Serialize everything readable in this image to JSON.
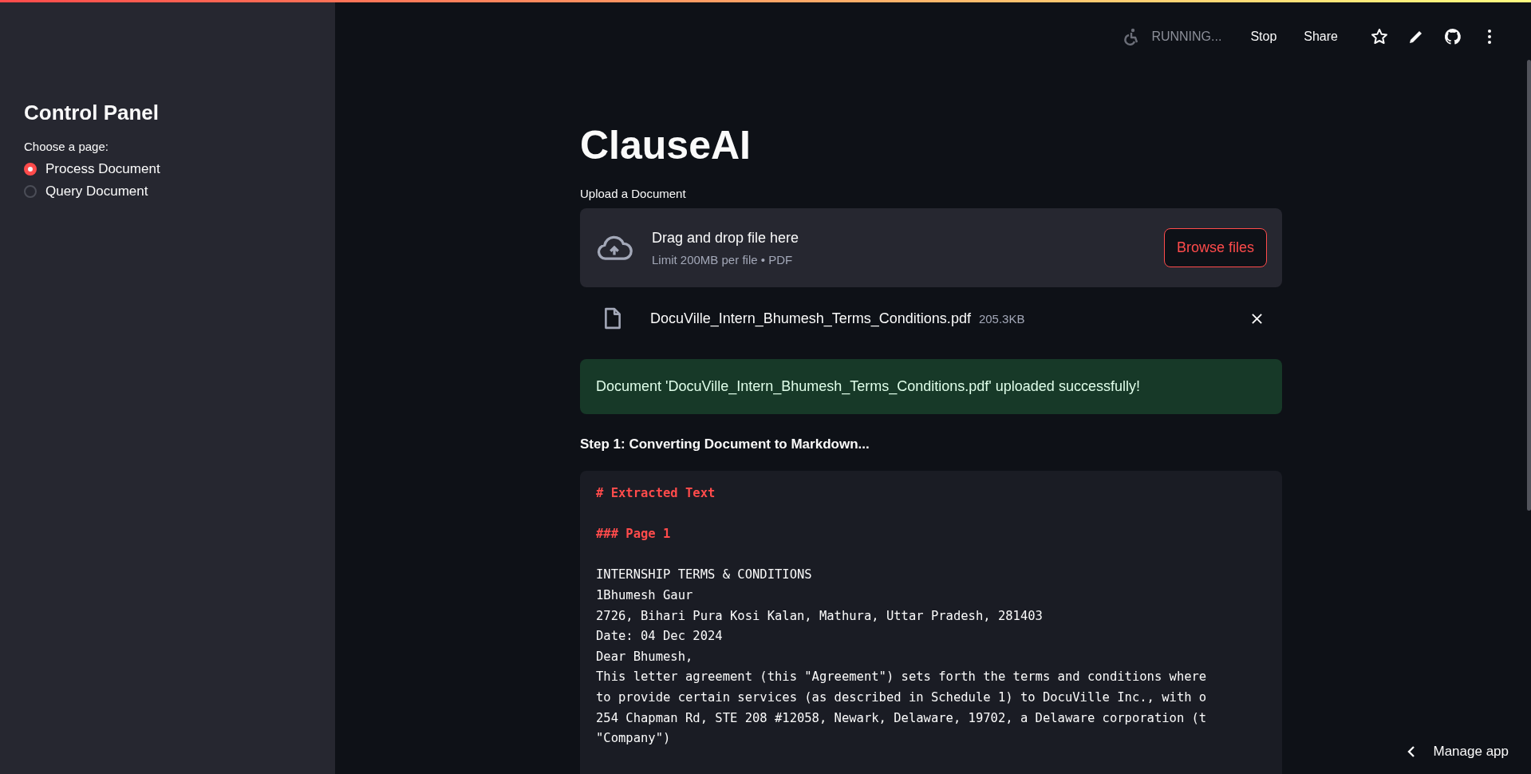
{
  "sidebar": {
    "title": "Control Panel",
    "radio_label": "Choose a page:",
    "options": [
      {
        "label": "Process Document",
        "selected": true
      },
      {
        "label": "Query Document",
        "selected": false
      }
    ]
  },
  "header": {
    "status": "RUNNING...",
    "buttons": [
      "Stop",
      "Share"
    ]
  },
  "main": {
    "title": "ClauseAI",
    "uploader": {
      "label": "Upload a Document",
      "drop_text": "Drag and drop file here",
      "limit": "Limit 200MB per file • PDF",
      "button": "Browse files"
    },
    "file": {
      "name": "DocuVille_Intern_Bhumesh_Terms_Conditions.pdf",
      "size": "205.3KB"
    },
    "success": "Document 'DocuVille_Intern_Bhumesh_Terms_Conditions.pdf' uploaded successfully!",
    "step": "Step 1: Converting Document to Markdown...",
    "code_lines": [
      {
        "kind": "heading",
        "text": "# Extracted Text"
      },
      {
        "kind": "heading",
        "text": "### Page 1"
      },
      {
        "kind": "text",
        "text": "INTERNSHIP TERMS & CONDITIONS"
      },
      {
        "kind": "text",
        "text": "1Bhumesh Gaur"
      },
      {
        "kind": "text",
        "text": "2726, Bihari Pura Kosi Kalan, Mathura, Uttar Pradesh, 281403"
      },
      {
        "kind": "text",
        "text": "Date: 04 Dec 2024"
      },
      {
        "kind": "text",
        "text": "Dear Bhumesh,"
      },
      {
        "kind": "text",
        "text": "This letter agreement (this \"Agreement\") sets forth the terms and conditions where"
      },
      {
        "kind": "text",
        "text": "to provide certain services (as described in Schedule 1) to DocuVille Inc., with o"
      },
      {
        "kind": "text",
        "text": "254 Chapman Rd, STE 208 #12058, Newark, Delaware, 19702, a Delaware corporation (t"
      },
      {
        "kind": "text",
        "text": "\"Company\")"
      }
    ]
  },
  "manage_app": "Manage app"
}
